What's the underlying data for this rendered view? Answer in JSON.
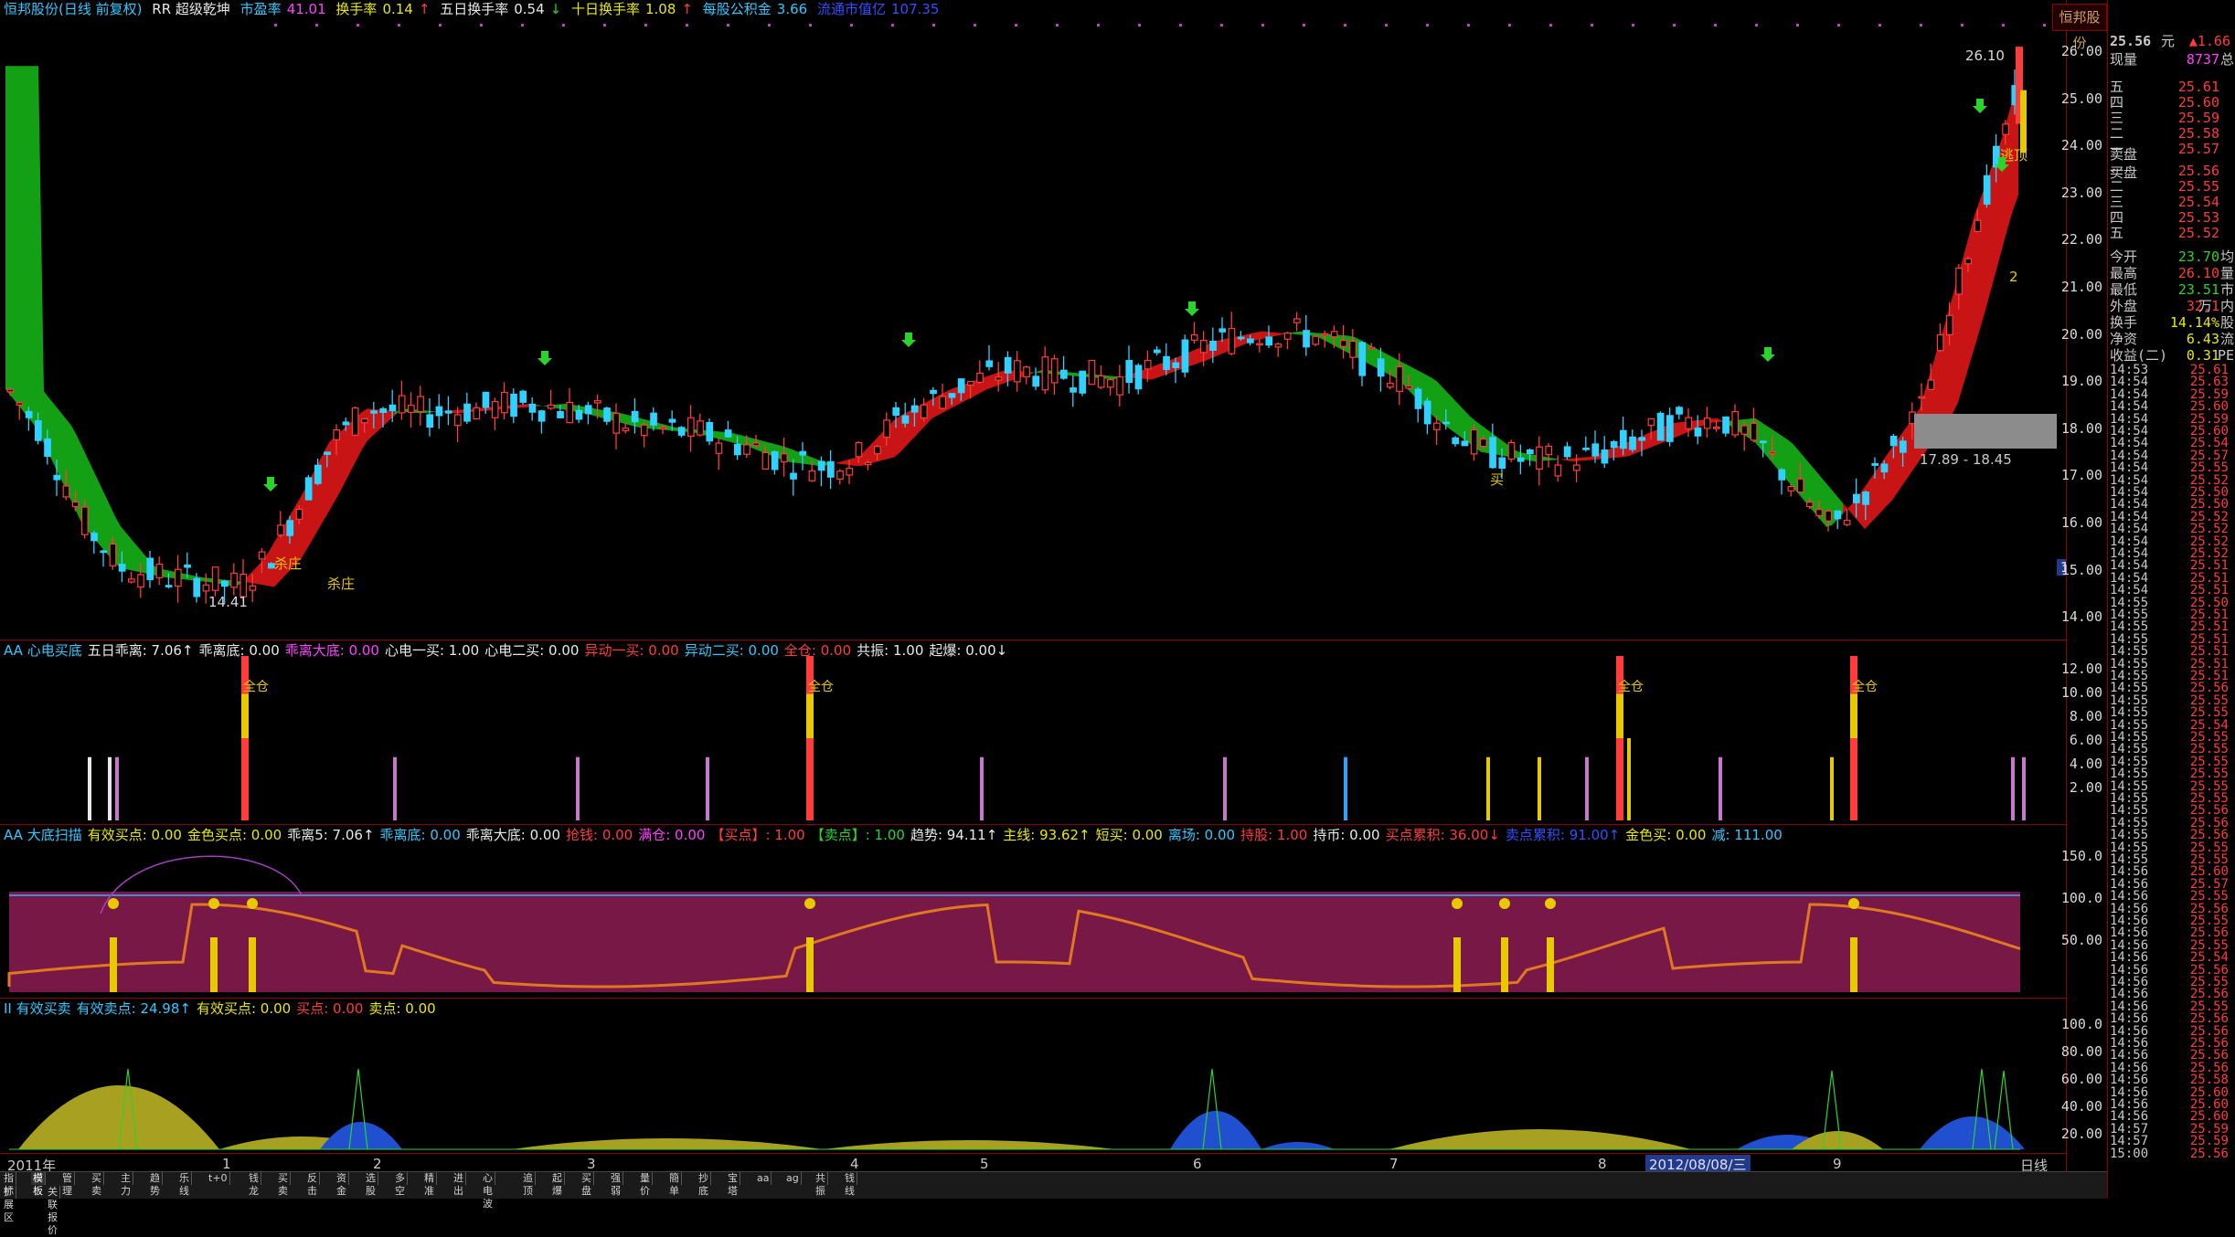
{
  "stock_header": {
    "name": "恒邦股份(日线 前复权)",
    "indicator": "RR  超级乾坤",
    "pe_label": "市盈率",
    "pe_value": "41.01",
    "turnover_label": "换手率",
    "turnover_value": "0.14",
    "turnover5_label": "五日换手率",
    "turnover5_value": "0.54",
    "turnover10_label": "十日换手率",
    "turnover10_value": "1.08",
    "reserve_label": "每股公积金",
    "reserve_value": "3.66",
    "float_label": "流通市值亿",
    "float_value": "107.35"
  },
  "logo_text": "恒邦股份",
  "price_axis": [
    "26.00",
    "25.00",
    "24.00",
    "23.00",
    "22.00",
    "21.00",
    "20.00",
    "19.00",
    "18.00",
    "17.00",
    "16.00",
    "15.00",
    "14.00"
  ],
  "price_annotations": {
    "high": "26.10",
    "low": "14.41",
    "range_box": "17.89 - 18.45",
    "current_marker": "15.02",
    "label_kill1": "杀庄",
    "label_kill2": "杀庄",
    "label_buy": "买",
    "label_escape": "逃顶",
    "label_num": "2"
  },
  "panel1": {
    "header": [
      {
        "t": "AA  心电买底",
        "c": "#30c8ff"
      },
      {
        "t": "五日乖离: 7.06↑",
        "c": "#e8e8e8"
      },
      {
        "t": "乖离底: 0.00",
        "c": "#e8e8e8"
      },
      {
        "t": "乖离大底: 0.00",
        "c": "#ff40ff"
      },
      {
        "t": "心电一买: 1.00",
        "c": "#e8e8e8"
      },
      {
        "t": "心电二买: 0.00",
        "c": "#e8e8e8"
      },
      {
        "t": "异动一买: 0.00",
        "c": "#ff3b3b"
      },
      {
        "t": "异动二买: 0.00",
        "c": "#30c8ff"
      },
      {
        "t": "全仓: 0.00",
        "c": "#ff3b3b"
      },
      {
        "t": "共振: 1.00",
        "c": "#e8e8e8"
      },
      {
        "t": "起爆: 0.00↓",
        "c": "#e8e8e8"
      }
    ],
    "axis": [
      "12.00",
      "10.00",
      "8.00",
      "6.00",
      "4.00",
      "2.00"
    ],
    "label_full": "全仓"
  },
  "panel2": {
    "header": [
      {
        "t": "AA  大底扫描",
        "c": "#30c8ff"
      },
      {
        "t": "有效买点: 0.00",
        "c": "#e8e800"
      },
      {
        "t": "金色买点: 0.00",
        "c": "#e8e800"
      },
      {
        "t": "乖离5: 7.06↑",
        "c": "#e8e8e8"
      },
      {
        "t": "乖离底: 0.00",
        "c": "#30c8ff"
      },
      {
        "t": "乖离大底: 0.00",
        "c": "#e8e8e8"
      },
      {
        "t": "抢钱: 0.00",
        "c": "#ff3b3b"
      },
      {
        "t": "满仓: 0.00",
        "c": "#ff40ff"
      },
      {
        "t": "【买点】: 1.00",
        "c": "#ff3b3b"
      },
      {
        "t": "【卖点】: 1.00",
        "c": "#2bd32b"
      },
      {
        "t": "趋势: 94.11↑",
        "c": "#e8e8e8"
      },
      {
        "t": "主线: 93.62↑",
        "c": "#e8e800"
      },
      {
        "t": "短买: 0.00",
        "c": "#e8e800"
      },
      {
        "t": "离场: 0.00",
        "c": "#30c8ff"
      },
      {
        "t": "持股: 1.00",
        "c": "#ff3b3b"
      },
      {
        "t": "持币: 0.00",
        "c": "#e8e8e8"
      },
      {
        "t": "买点累积: 36.00↓",
        "c": "#ff3b3b"
      },
      {
        "t": "卖点累积: 91.00↑",
        "c": "#3050ff"
      },
      {
        "t": "金色买: 0.00",
        "c": "#e8e800"
      },
      {
        "t": "减: 111.00",
        "c": "#30c8ff"
      }
    ],
    "axis": [
      "150.0",
      "100.0",
      "50.00"
    ]
  },
  "panel3": {
    "header": [
      {
        "t": "II  有效买卖",
        "c": "#30c8ff"
      },
      {
        "t": "有效卖点: 24.98↑",
        "c": "#30c8ff"
      },
      {
        "t": "有效买点: 0.00",
        "c": "#e8e800"
      },
      {
        "t": "买点: 0.00",
        "c": "#ff3b3b"
      },
      {
        "t": "卖点: 0.00",
        "c": "#e8e800"
      }
    ],
    "axis": [
      "100.0",
      "80.00",
      "60.00",
      "40.00",
      "20.00"
    ]
  },
  "x_axis": {
    "year": "2011年",
    "months": [
      "1",
      "2",
      "3",
      "4",
      "5",
      "6",
      "7",
      "8",
      "9"
    ],
    "date_highlight": "2012/08/08/三",
    "period": "日线"
  },
  "bottom_tabs": [
    "指标",
    "模板",
    "管理",
    "买卖",
    "主力",
    "趋势",
    "乐线",
    "t+0",
    "钱龙",
    "买卖",
    "反击",
    "资金",
    "选股",
    "多空",
    "精准",
    "进出",
    "心电波",
    "追顶",
    "起爆",
    "买盘",
    "强弱",
    "量价",
    "簡单",
    "抄底",
    "宝塔",
    "aa",
    "ag",
    "共振",
    "钱线"
  ],
  "bottom_tabs2": [
    "扩展区",
    "关联报价"
  ],
  "quote": {
    "price": "25.56",
    "unit": "元",
    "change": "▲1.66",
    "volume_label": "现量",
    "volume": "8737",
    "volume_unit": "总",
    "sell_label": "卖盘",
    "buy_label": "买盘",
    "asks": [
      {
        "l": "五",
        "v": "25.61"
      },
      {
        "l": "四",
        "v": "25.60"
      },
      {
        "l": "三",
        "v": "25.59"
      },
      {
        "l": "二",
        "v": "25.58"
      },
      {
        "l": "一",
        "v": "25.57"
      }
    ],
    "bids": [
      {
        "l": "一",
        "v": "25.56"
      },
      {
        "l": "二",
        "v": "25.55"
      },
      {
        "l": "三",
        "v": "25.54"
      },
      {
        "l": "四",
        "v": "25.53"
      },
      {
        "l": "五",
        "v": "25.52"
      }
    ],
    "stats": [
      {
        "l": "今开",
        "v": "23.70",
        "u": "均",
        "c": "#2bd32b"
      },
      {
        "l": "最高",
        "v": "26.10",
        "u": "量",
        "c": "#ff3b3b"
      },
      {
        "l": "最低",
        "v": "23.51",
        "u": "市",
        "c": "#2bd32b"
      },
      {
        "l": "外盘",
        "v": "32.1",
        "u": "万 内",
        "c": "#ff3b3b"
      },
      {
        "l": "换手",
        "v": "14.14%",
        "u": "股",
        "c": "#e8e800"
      },
      {
        "l": "净资",
        "v": "6.43",
        "u": "流",
        "c": "#e8e800"
      },
      {
        "l": "收益(二)",
        "v": "0.31",
        "u": "PE",
        "c": "#e8e800"
      }
    ],
    "trades": [
      [
        "14:53",
        "25.61"
      ],
      [
        "14:54",
        "25.63"
      ],
      [
        "14:54",
        "25.59"
      ],
      [
        "14:54",
        "25.60"
      ],
      [
        "14:54",
        "25.59"
      ],
      [
        "14:54",
        "25.60"
      ],
      [
        "14:54",
        "25.54"
      ],
      [
        "14:54",
        "25.57"
      ],
      [
        "14:54",
        "25.55"
      ],
      [
        "14:54",
        "25.52"
      ],
      [
        "14:54",
        "25.50"
      ],
      [
        "14:54",
        "25.50"
      ],
      [
        "14:54",
        "25.52"
      ],
      [
        "14:54",
        "25.52"
      ],
      [
        "14:54",
        "25.52"
      ],
      [
        "14:54",
        "25.52"
      ],
      [
        "14:54",
        "25.51"
      ],
      [
        "14:54",
        "25.51"
      ],
      [
        "14:54",
        "25.51"
      ],
      [
        "14:55",
        "25.50"
      ],
      [
        "14:55",
        "25.51"
      ],
      [
        "14:55",
        "25.51"
      ],
      [
        "14:55",
        "25.51"
      ],
      [
        "14:55",
        "25.51"
      ],
      [
        "14:55",
        "25.51"
      ],
      [
        "14:55",
        "25.51"
      ],
      [
        "14:55",
        "25.56"
      ],
      [
        "14:55",
        "25.55"
      ],
      [
        "14:55",
        "25.55"
      ],
      [
        "14:55",
        "25.54"
      ],
      [
        "14:55",
        "25.55"
      ],
      [
        "14:55",
        "25.55"
      ],
      [
        "14:55",
        "25.55"
      ],
      [
        "14:55",
        "25.55"
      ],
      [
        "14:55",
        "25.55"
      ],
      [
        "14:55",
        "25.55"
      ],
      [
        "14:55",
        "25.56"
      ],
      [
        "14:55",
        "25.56"
      ],
      [
        "14:55",
        "25.56"
      ],
      [
        "14:55",
        "25.55"
      ],
      [
        "14:55",
        "25.55"
      ],
      [
        "14:56",
        "25.60"
      ],
      [
        "14:56",
        "25.57"
      ],
      [
        "14:56",
        "25.55"
      ],
      [
        "14:56",
        "25.56"
      ],
      [
        "14:56",
        "25.55"
      ],
      [
        "14:56",
        "25.56"
      ],
      [
        "14:56",
        "25.55"
      ],
      [
        "14:56",
        "25.54"
      ],
      [
        "14:56",
        "25.56"
      ],
      [
        "14:56",
        "25.55"
      ],
      [
        "14:56",
        "25.56"
      ],
      [
        "14:56",
        "25.55"
      ],
      [
        "14:56",
        "25.56"
      ],
      [
        "14:56",
        "25.56"
      ],
      [
        "14:56",
        "25.56"
      ],
      [
        "14:56",
        "25.56"
      ],
      [
        "14:56",
        "25.56"
      ],
      [
        "14:56",
        "25.58"
      ],
      [
        "14:56",
        "25.60"
      ],
      [
        "14:56",
        "25.60"
      ],
      [
        "14:56",
        "25.60"
      ],
      [
        "14:57",
        "25.59"
      ],
      [
        "14:57",
        "25.59"
      ],
      [
        "15:00",
        "25.56"
      ]
    ]
  },
  "colors": {
    "up": "#ff3b3b",
    "down": "#30d0ff",
    "ribbon_up": "#c81414",
    "ribbon_down": "#14a014",
    "frame": "#8a0000",
    "panel2_fill": "#781846"
  }
}
